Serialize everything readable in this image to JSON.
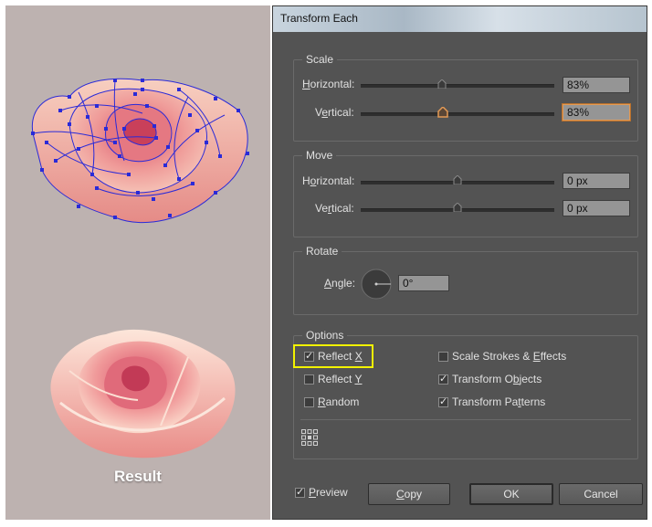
{
  "left": {
    "result_label": "Result"
  },
  "dialog": {
    "title": "Transform Each",
    "scale": {
      "legend": "Scale",
      "horizontal_label_u": "H",
      "horizontal_label_rest": "orizontal:",
      "horizontal_value": "83%",
      "horizontal_fraction": 0.83,
      "vertical_label_pre": "V",
      "vertical_label_u": "e",
      "vertical_label_rest": "rtical:",
      "vertical_value": "83%",
      "vertical_fraction": 0.83
    },
    "move": {
      "legend": "Move",
      "horizontal_label_pre": "H",
      "horizontal_label_u": "o",
      "horizontal_label_rest": "rizontal:",
      "horizontal_value": "0 px",
      "vertical_label_pre": "Ve",
      "vertical_label_u": "r",
      "vertical_label_rest": "tical:",
      "vertical_value": "0 px"
    },
    "rotate": {
      "legend": "Rotate",
      "angle_label_pre": "",
      "angle_label_u": "A",
      "angle_label_rest": "ngle:",
      "angle_value": "0°"
    },
    "options": {
      "legend": "Options",
      "reflect_x": {
        "pre": "Reflect ",
        "u": "X",
        "rest": "",
        "checked": true
      },
      "reflect_y": {
        "pre": "Reflect ",
        "u": "Y",
        "rest": "",
        "checked": false
      },
      "random": {
        "pre": "",
        "u": "R",
        "rest": "andom",
        "checked": false
      },
      "scale_strokes": {
        "pre": "Scale Strokes & ",
        "u": "E",
        "rest": "ffects",
        "checked": false
      },
      "transform_objects": {
        "pre": "Transform O",
        "u": "b",
        "rest": "jects",
        "checked": true
      },
      "transform_patterns": {
        "pre": "Transform Pa",
        "u": "t",
        "rest": "terns",
        "checked": true
      }
    },
    "preview": {
      "pre": "",
      "u": "P",
      "rest": "review",
      "checked": true
    },
    "buttons": {
      "copy_u": "C",
      "copy_rest": "opy",
      "ok": "OK",
      "cancel": "Cancel"
    },
    "highlight_color": "#f2f200",
    "accent_color": "#e39a55"
  }
}
